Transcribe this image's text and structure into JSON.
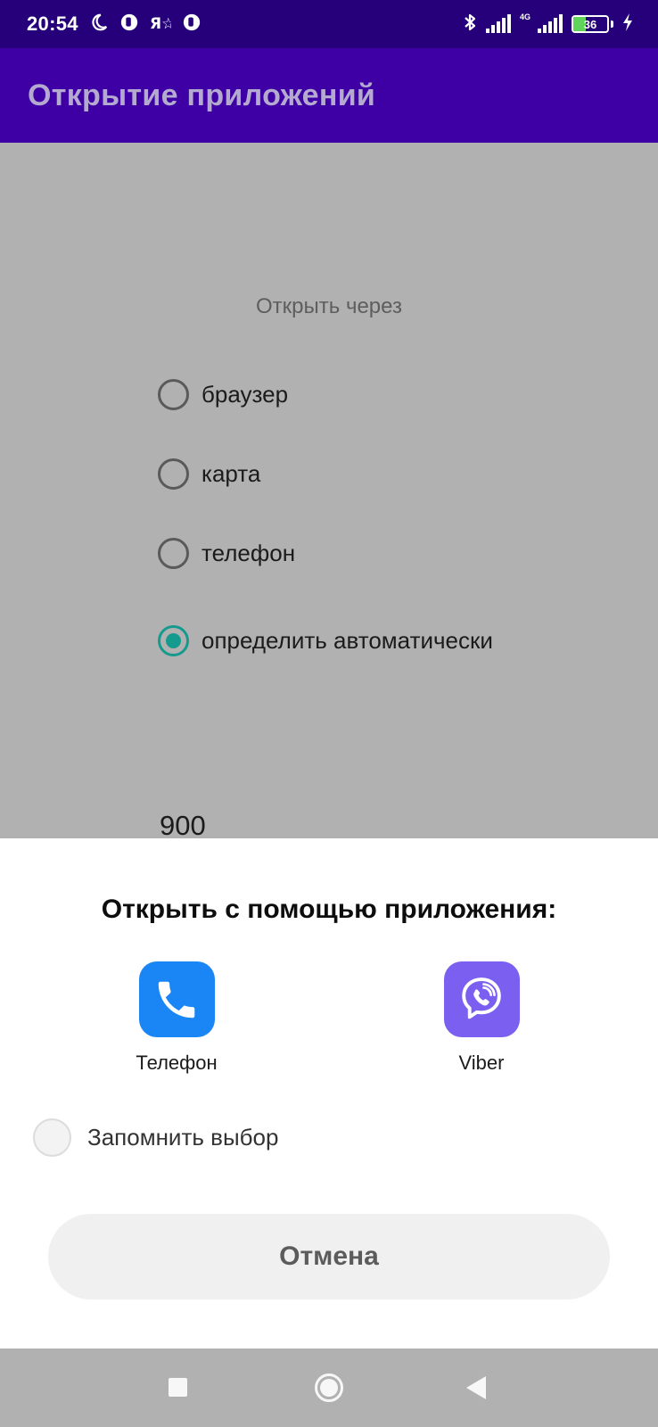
{
  "status_bar": {
    "time": "20:54",
    "notification_icons": [
      "moon-icon",
      "round-app-icon",
      "yandex-icon",
      "round-app-icon"
    ],
    "network_label": "4G",
    "battery_level": "36",
    "battery_percent": 36,
    "charging": true
  },
  "app_bar": {
    "title": "Открытие приложений",
    "background_color": "#3e00a4"
  },
  "form": {
    "section_label": "Открыть через",
    "options": [
      {
        "label": "браузер",
        "checked": false
      },
      {
        "label": "карта",
        "checked": false
      },
      {
        "label": "телефон",
        "checked": false
      },
      {
        "label": "определить автоматически",
        "checked": true
      }
    ],
    "accent_color": "#159b8e",
    "value": "900"
  },
  "chooser": {
    "title": "Открыть с помощью приложения:",
    "apps": [
      {
        "label": "Телефон",
        "icon": "phone-icon",
        "color": "#1a86f5"
      },
      {
        "label": "Viber",
        "icon": "viber-icon",
        "color": "#7a5ff0"
      }
    ],
    "remember_label": "Запомнить выбор",
    "remember_checked": false,
    "cancel_label": "Отмена"
  },
  "nav_bar": {
    "buttons": [
      "recents-icon",
      "home-icon",
      "back-icon"
    ]
  }
}
